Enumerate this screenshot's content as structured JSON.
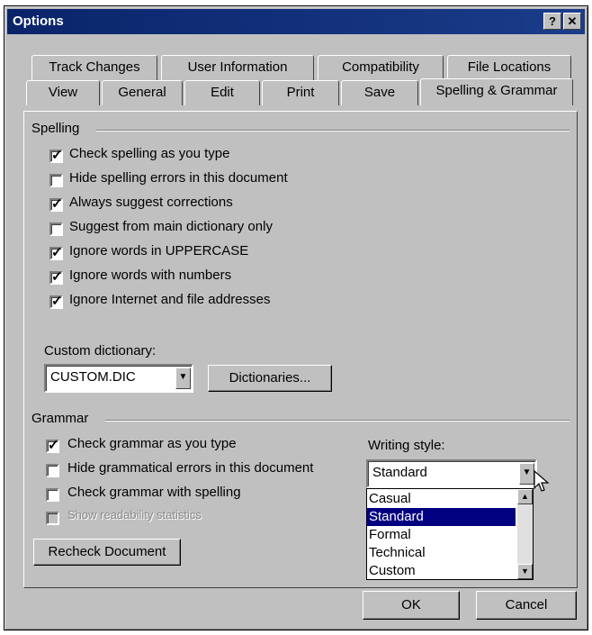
{
  "window": {
    "title": "Options",
    "help_button": "?",
    "close_button": "✕"
  },
  "tabs": {
    "row1": [
      "Track Changes",
      "User Information",
      "Compatibility",
      "File Locations"
    ],
    "row2": [
      "View",
      "General",
      "Edit",
      "Print",
      "Save",
      "Spelling & Grammar"
    ],
    "active": "Spelling & Grammar"
  },
  "spelling": {
    "group_label": "Spelling",
    "options": [
      {
        "label": "Check spelling as you type",
        "checked": true
      },
      {
        "label": "Hide spelling errors in this document",
        "checked": false
      },
      {
        "label": "Always suggest corrections",
        "checked": true
      },
      {
        "label": "Suggest from main dictionary only",
        "checked": false
      },
      {
        "label": "Ignore words in UPPERCASE",
        "checked": true
      },
      {
        "label": "Ignore words with numbers",
        "checked": true
      },
      {
        "label": "Ignore Internet and file addresses",
        "checked": true
      }
    ],
    "custom_dictionary_label": "Custom dictionary:",
    "custom_dictionary_value": "CUSTOM.DIC",
    "dictionaries_button": "Dictionaries..."
  },
  "grammar": {
    "group_label": "Grammar",
    "options": [
      {
        "label": "Check grammar as you type",
        "checked": true,
        "disabled": false
      },
      {
        "label": "Hide grammatical errors in this document",
        "checked": false,
        "disabled": false
      },
      {
        "label": "Check grammar with spelling",
        "checked": false,
        "disabled": false
      },
      {
        "label": "Show readability statistics",
        "checked": false,
        "disabled": true
      }
    ],
    "writing_style_label": "Writing style:",
    "writing_style_value": "Standard",
    "writing_style_options": [
      "Casual",
      "Standard",
      "Formal",
      "Technical",
      "Custom"
    ],
    "writing_style_highlighted": "Standard",
    "recheck_button": "Recheck Document"
  },
  "footer": {
    "ok_button": "OK",
    "cancel_button": "Cancel"
  },
  "colors": {
    "face": "#c0c0c0",
    "title_bar": "#0a246a",
    "highlight": "#000080"
  }
}
